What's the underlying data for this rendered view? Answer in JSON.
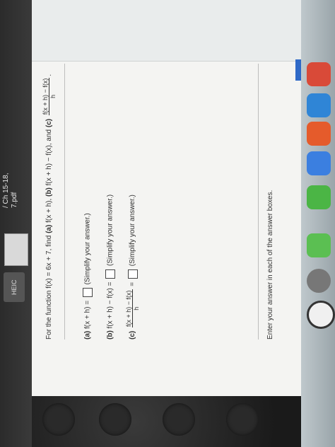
{
  "finder": {
    "file_label": "/ Ch 15-18, 7.pdf",
    "heic_label": "HEIC"
  },
  "question": {
    "prompt_pre": "For the function f(x) = 6x + 7, find",
    "part_a_tag": "(a)",
    "part_a_expr": "f(x + h),",
    "part_b_tag": "(b)",
    "part_b_expr": "f(x + h) − f(x),",
    "and": "and",
    "part_c_tag": "(c)",
    "frac_num": "f(x + h) − f(x)",
    "frac_den": "h",
    "period": "."
  },
  "answers": {
    "a_tag": "(a)",
    "a_lhs": "f(x + h) =",
    "b_tag": "(b)",
    "b_lhs": "f(x + h) − f(x) =",
    "c_tag": "(c)",
    "c_num": "f(x + h) − f(x)",
    "c_den": "h",
    "c_eq": "=",
    "hint": "(Simplify your answer.)"
  },
  "footer": {
    "instruction": "Enter your answer in each of the answer boxes."
  },
  "colors": {
    "page_bg": "#f4f4f2",
    "topbar_bg": "#e9ecec",
    "accent_blue": "#2f69c7"
  },
  "dock_icons": [
    "red-app-icon",
    "blue-app-icon",
    "orange-app-icon",
    "blue-app-icon",
    "green-app-icon",
    "gray-app-icon",
    "chrome-icon"
  ]
}
